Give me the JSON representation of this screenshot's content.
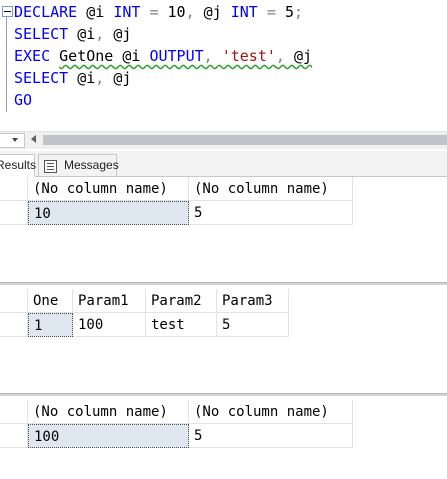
{
  "editor": {
    "line1": {
      "kw_declare": "DECLARE",
      "v_i": "@i",
      "kw_int1": "INT",
      "eq1": " = ",
      "n10": "10",
      "comma1": ",",
      "v_j": "@j",
      "kw_int2": "INT",
      "eq2": " = ",
      "n5": "5",
      "semi": ";"
    },
    "line2": {
      "kw_select": "SELECT",
      "v_i": "@i",
      "comma": ",",
      "v_j": "@j"
    },
    "line3": {
      "kw_exec": "EXEC",
      "proc": "GetOne",
      "v_i": "@i",
      "kw_output": "OUTPUT",
      "comma1": ",",
      "str": "'test'",
      "comma2": ",",
      "v_j": "@j"
    },
    "line4": {
      "kw_select": "SELECT",
      "v_i": "@i",
      "comma": ",",
      "v_j": "@j"
    },
    "line5": {
      "kw_go": "GO"
    }
  },
  "tabs": {
    "results": "Results",
    "messages": "Messages"
  },
  "results": [
    {
      "columns": [
        "(No column name)",
        "(No column name)"
      ],
      "rows": [
        [
          "10",
          "5"
        ]
      ]
    },
    {
      "columns": [
        "One",
        "Param1",
        "Param2",
        "Param3"
      ],
      "rows": [
        [
          "1",
          "100",
          "test",
          "5"
        ]
      ]
    },
    {
      "columns": [
        "(No column name)",
        "(No column name)"
      ],
      "rows": [
        [
          "100",
          "5"
        ]
      ]
    }
  ],
  "colors": {
    "keyword": "#0000ff",
    "string": "#a31515",
    "selected_cell": "#dfe8f0",
    "squiggle": "#2aa02a"
  },
  "icons": [
    "collapse-minus-icon",
    "zoom-dropdown-arrow-icon",
    "scroll-left-arrow-icon",
    "messages-icon"
  ]
}
